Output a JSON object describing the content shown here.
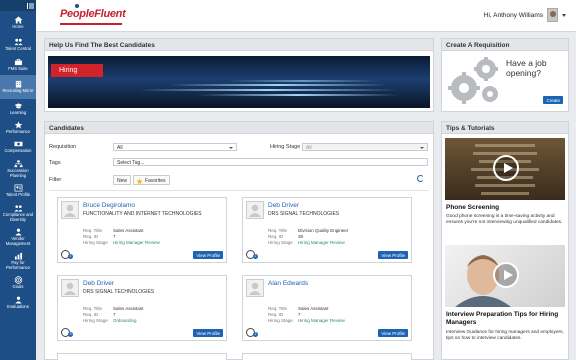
{
  "brand": {
    "name": "PeopleFluent",
    "accent": "#c62031",
    "nav_bg": "#1d4f86"
  },
  "user": {
    "greeting": "Hi, Anthony Williams"
  },
  "sidebar": {
    "items": [
      {
        "label": "Home",
        "icon": "home-icon"
      },
      {
        "label": "Talent Central",
        "icon": "people-icon"
      },
      {
        "label": "FMS Suite",
        "icon": "briefcase-icon"
      },
      {
        "label": "Recruiting Mirror",
        "icon": "building-icon",
        "active": true
      },
      {
        "label": "Learning",
        "icon": "graduation-cap-icon"
      },
      {
        "label": "Performance",
        "icon": "star-icon"
      },
      {
        "label": "Compensation",
        "icon": "money-icon"
      },
      {
        "label": "Succession Planning",
        "icon": "org-chart-icon"
      },
      {
        "label": "Talent Profile",
        "icon": "profile-icon"
      },
      {
        "label": "Compliance and Diversity",
        "icon": "compliance-icon"
      },
      {
        "label": "Vendor Management",
        "icon": "vendor-icon"
      },
      {
        "label": "Pay for Performance",
        "icon": "bar-chart-icon"
      },
      {
        "label": "Goals",
        "icon": "target-icon"
      },
      {
        "label": "Evaluations",
        "icon": "evaluations-icon"
      }
    ]
  },
  "help": {
    "title": "Help Us Find The Best Candidates",
    "banner_tag": "Hiring"
  },
  "requisition": {
    "title": "Create A Requisition",
    "text_line1": "Have a job",
    "text_line2": "opening?",
    "button": "Create"
  },
  "candidates": {
    "title": "Candidates",
    "requisition_label": "Requisition",
    "requisition_value": "All",
    "hiring_stage_label": "Hiring Stage",
    "hiring_stage_value": "All",
    "tags_label": "Tags",
    "tags_placeholder": "Select Tag...",
    "filter_label": "Filter",
    "filter_new": "New",
    "filter_favorites": "Favorites",
    "field_labels": {
      "title": "Req. Title",
      "id": "Req. ID",
      "stage": "Hiring Stage"
    },
    "view_profile": "View Profile",
    "cards": [
      {
        "name": "Bruce Degirolamo",
        "company": "FUNCTIONALITY AND INTERNET TECHNOLOGIES",
        "req_title": "Sales Assistant",
        "req_id": "7",
        "stage": "Hiring Manager Review",
        "badge_count": "2"
      },
      {
        "name": "Deb Driver",
        "company": "DRS SIGNAL TECHNOLOGIES",
        "req_title": "Division Quality Engineer",
        "req_id": "38",
        "stage": "Hiring Manager Review",
        "badge_count": "2"
      },
      {
        "name": "Deb Driver",
        "company": "DRS SIGNAL TECHNOLOGIES",
        "req_title": "Sales Assistant",
        "req_id": "7",
        "stage": "Onboarding",
        "badge_count": "3"
      },
      {
        "name": "Alan Edwards",
        "company": "",
        "req_title": "Sales Assistant",
        "req_id": "7",
        "stage": "Hiring Manager Review",
        "badge_count": "2"
      }
    ]
  },
  "tips": {
    "title": "Tips & Tutorials",
    "items": [
      {
        "title": "Phone Screening",
        "desc": "Good phone screening is a time-saving activity and ensures you're not interviewing unqualified candidates."
      },
      {
        "title": "Interview Preparation Tips for Hiring Managers",
        "desc": "Interview Guidance for hiring managers and employers, tips on how to interview candidates."
      }
    ]
  }
}
